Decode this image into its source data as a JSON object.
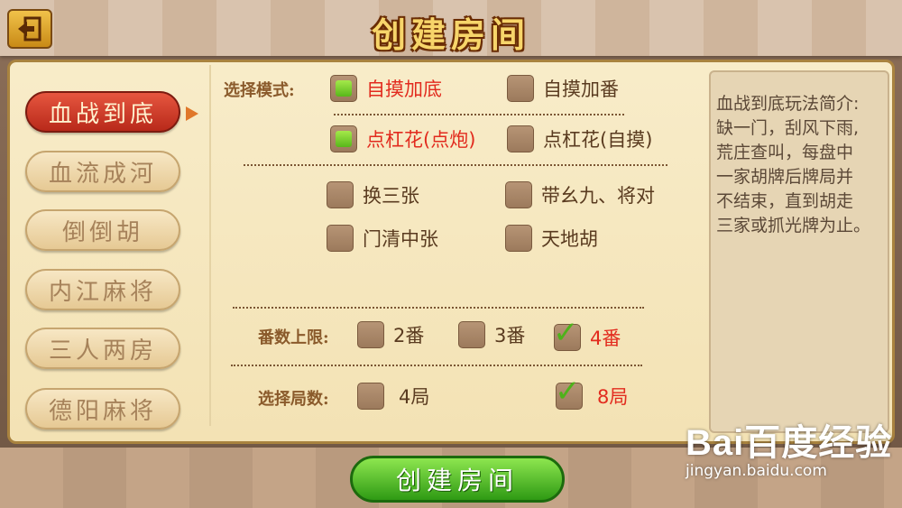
{
  "header": {
    "title": "创建房间",
    "back_icon": "exit-door-icon"
  },
  "sidebar": {
    "items": [
      {
        "label": "血战到底",
        "active": true
      },
      {
        "label": "血流成河",
        "active": false
      },
      {
        "label": "倒倒胡",
        "active": false
      },
      {
        "label": "内江麻将",
        "active": false
      },
      {
        "label": "三人两房",
        "active": false
      },
      {
        "label": "德阳麻将",
        "active": false
      }
    ]
  },
  "options": {
    "mode_label": "选择模式:",
    "mode": [
      {
        "label": "自摸加底",
        "checked": true
      },
      {
        "label": "自摸加番",
        "checked": false
      },
      {
        "label": "点杠花(点炮)",
        "checked": true
      },
      {
        "label": "点杠花(自摸)",
        "checked": false
      }
    ],
    "extras": [
      {
        "label": "换三张",
        "checked": false
      },
      {
        "label": "带幺九、将对",
        "checked": false
      },
      {
        "label": "门清中张",
        "checked": false
      },
      {
        "label": "天地胡",
        "checked": false
      }
    ],
    "fan_label": "番数上限:",
    "fan": [
      {
        "label": "2番",
        "checked": false
      },
      {
        "label": "3番",
        "checked": false
      },
      {
        "label": "4番",
        "checked": true
      }
    ],
    "rounds_label": "选择局数:",
    "rounds": [
      {
        "label": "4局",
        "checked": false
      },
      {
        "label": "8局",
        "checked": true
      }
    ]
  },
  "description": {
    "lines": [
      "血战到底玩法简介:",
      "缺一门，刮风下雨,",
      "荒庄查叫，每盘中",
      "一家胡牌后牌局并",
      "不结束，直到胡走",
      "三家或抓光牌为止。"
    ]
  },
  "create_button": {
    "label": "创建房间"
  },
  "watermark": {
    "logo": "Bai百度经验",
    "url": "jingyan.baidu.com"
  }
}
